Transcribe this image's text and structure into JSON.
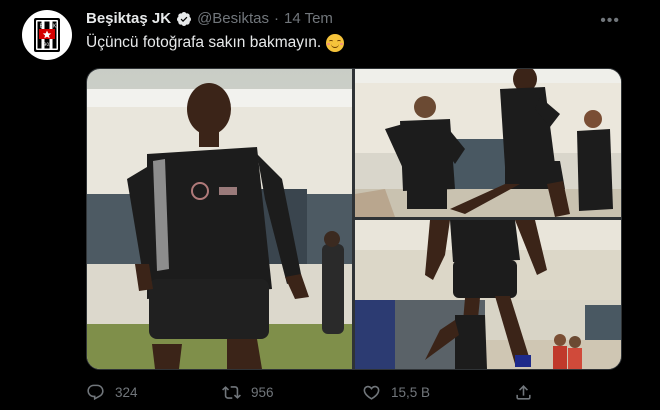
{
  "tweet": {
    "author_name": "Beşiktaş JK",
    "handle": "@Besiktas",
    "separator": "·",
    "date": "14 Tem",
    "more_label": "•••",
    "text": "Üçüncü fotoğrafa sakın bakmayın.",
    "emoji": "smiling-face-with-blush",
    "avatar_letters": [
      "B",
      "J",
      "K"
    ],
    "avatar_year": "1903"
  },
  "media": {
    "photos": [
      {
        "id": "photo-1"
      },
      {
        "id": "photo-2"
      },
      {
        "id": "photo-3"
      }
    ]
  },
  "actions": {
    "reply_count": "324",
    "retweet_count": "956",
    "like_count": "15,5 B",
    "icons": [
      "reply-icon",
      "retweet-icon",
      "like-icon",
      "share-icon"
    ]
  },
  "colors": {
    "background": "#000000",
    "text": "#e7e9ea",
    "secondary": "#71767b",
    "verified": "#1d9bf0",
    "border": "#2f3336"
  }
}
